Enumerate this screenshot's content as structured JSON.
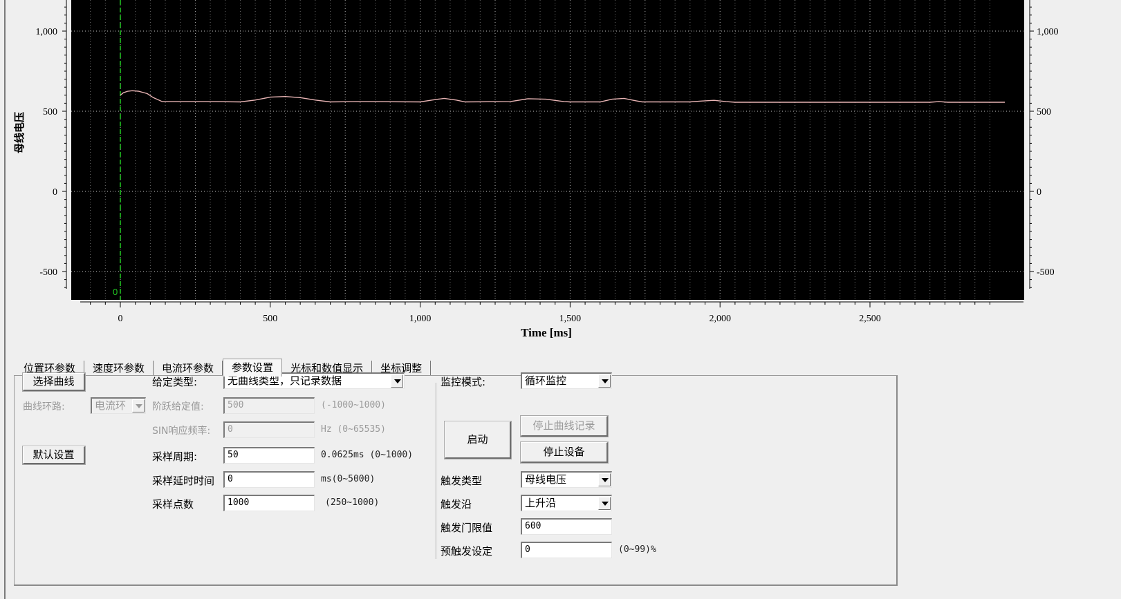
{
  "colors": {
    "plot_background": "#000000",
    "grid": "#c8c8c8",
    "trace": "#e8b4b4",
    "cursor": "#22cc22"
  },
  "chart_data": {
    "type": "line",
    "ylabel": "母线电压",
    "xlabel": "Time [ms]",
    "xlim": [
      -150,
      2950
    ],
    "ylim": [
      -680,
      1180
    ],
    "x_ticks": [
      0,
      500,
      1000,
      1500,
      2000,
      2500
    ],
    "x_tick_labels": [
      "0",
      "500",
      "1,000",
      "1,500",
      "2,000",
      "2,500"
    ],
    "y_ticks": [
      1000,
      500,
      0,
      -500
    ],
    "y_tick_labels": [
      "1,000",
      "500",
      "0",
      "-500"
    ],
    "grid": true,
    "cursor": {
      "x": 0,
      "label": "0"
    },
    "series": [
      {
        "x": [
          0,
          10,
          25,
          40,
          60,
          90,
          110,
          140,
          300,
          400,
          450,
          500,
          550,
          600,
          650,
          700,
          800,
          1000,
          1040,
          1080,
          1120,
          1150,
          1300,
          1360,
          1420,
          1480,
          1500,
          1600,
          1640,
          1680,
          1720,
          1740,
          1900,
          1950,
          1980,
          2020,
          2050,
          2500,
          2700,
          2730,
          2760,
          2950
        ],
        "y": [
          600,
          615,
          625,
          628,
          625,
          610,
          585,
          560,
          560,
          558,
          570,
          588,
          592,
          585,
          570,
          558,
          560,
          558,
          570,
          580,
          570,
          558,
          560,
          578,
          575,
          560,
          558,
          558,
          575,
          580,
          565,
          558,
          558,
          565,
          568,
          560,
          556,
          556,
          556,
          560,
          556,
          556
        ]
      }
    ]
  },
  "tabs": [
    {
      "label": "位置环参数"
    },
    {
      "label": "速度环参数"
    },
    {
      "label": "电流环参数"
    },
    {
      "label": "参数设置",
      "active": true
    },
    {
      "label": "光标和数值显示"
    },
    {
      "label": "坐标调整"
    }
  ],
  "form": {
    "select_curve_btn": "选择曲线",
    "curve_loop_label": "曲线环路:",
    "curve_loop_value": "电流环",
    "default_settings_btn": "默认设置",
    "given_type_label": "给定类型:",
    "given_type_value": "无曲线类型，只记录数据",
    "step_value_label": "阶跃给定值:",
    "step_value": "500",
    "step_range": "(-1000~1000)",
    "sin_freq_label": "SIN响应频率:",
    "sin_freq_value": "0",
    "sin_freq_range": "Hz (0~65535)",
    "sample_period_label": "采样周期:",
    "sample_period_value": "50",
    "sample_period_range": "0.0625ms (0~1000)",
    "sample_delay_label": "采样延时时间",
    "sample_delay_value": "0",
    "sample_delay_range": "ms(0~5000)",
    "sample_points_label": "采样点数",
    "sample_points_value": "1000",
    "sample_points_range": "(250~1000)",
    "monitor_mode_label": "监控模式:",
    "monitor_mode_value": "循环监控",
    "start_btn": "启动",
    "stop_record_btn": "停止曲线记录",
    "stop_device_btn": "停止设备",
    "trigger_type_label": "触发类型",
    "trigger_type_value": "母线电压",
    "trigger_edge_label": "触发沿",
    "trigger_edge_value": "上升沿",
    "trigger_threshold_label": "触发门限值",
    "trigger_threshold_value": "600",
    "pretrigger_label": "预触发设定",
    "pretrigger_value": "0",
    "pretrigger_range": "(0~99)%"
  }
}
